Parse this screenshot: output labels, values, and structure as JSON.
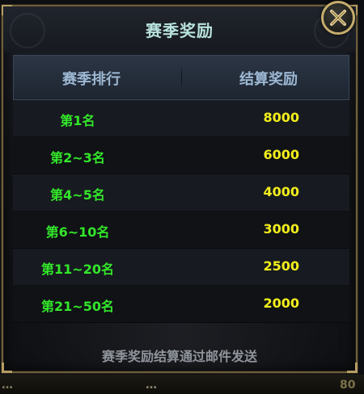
{
  "dialog": {
    "title": "赛季奖励",
    "table": {
      "headers": {
        "rank": "赛季排行",
        "reward": "结算奖励"
      },
      "rows": [
        {
          "rank": "第1名",
          "reward": "8000"
        },
        {
          "rank": "第2~3名",
          "reward": "6000"
        },
        {
          "rank": "第4~5名",
          "reward": "4000"
        },
        {
          "rank": "第6~10名",
          "reward": "3000"
        },
        {
          "rank": "第11~20名",
          "reward": "2500"
        },
        {
          "rank": "第21~50名",
          "reward": "2000"
        }
      ]
    },
    "footer_note": "赛季奖励结算通过邮件发送",
    "close_icon": "close-icon"
  },
  "background": {
    "left": "…",
    "middle": "…",
    "right": "80"
  },
  "colors": {
    "title": "#b8e2dd",
    "header_text": "#9db8d3",
    "rank_text": "#33e62a",
    "reward_text": "#f2ee1c",
    "note_text": "#8f949b",
    "frame_gold": "#c6ad6d"
  }
}
